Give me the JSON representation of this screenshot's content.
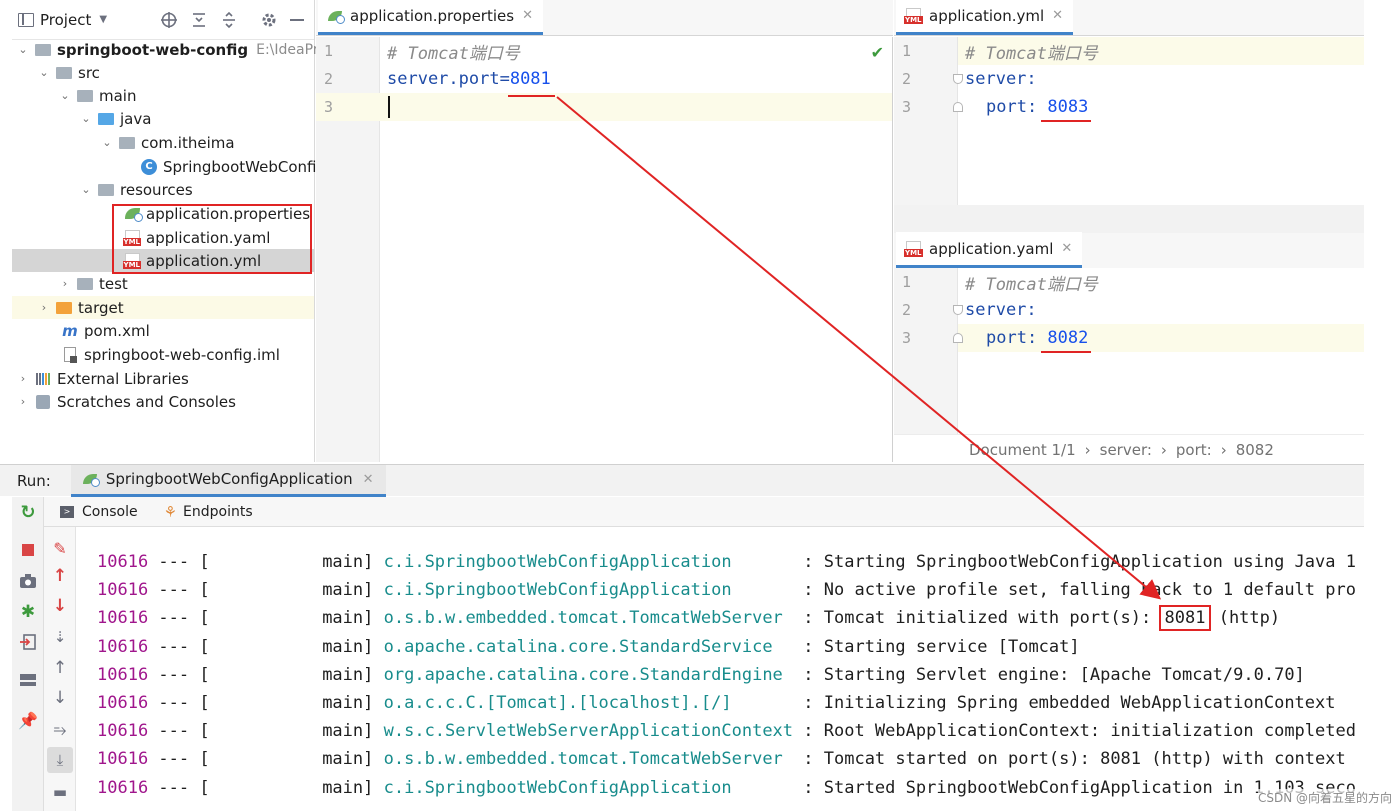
{
  "project": {
    "title": "Project",
    "tree": [
      {
        "label": "springboot-web-config",
        "hint": "E:\\IdeaProje"
      },
      {
        "label": "src"
      },
      {
        "label": "main"
      },
      {
        "label": "java"
      },
      {
        "label": "com.itheima"
      },
      {
        "label": "SpringbootWebConfi"
      },
      {
        "label": "resources"
      },
      {
        "label": "application.properties"
      },
      {
        "label": "application.yaml"
      },
      {
        "label": "application.yml"
      },
      {
        "label": "test"
      },
      {
        "label": "target"
      },
      {
        "label": "pom.xml"
      },
      {
        "label": "springboot-web-config.iml"
      },
      {
        "label": "External Libraries"
      },
      {
        "label": "Scratches and Consoles"
      }
    ]
  },
  "editor_main": {
    "tab": "application.properties",
    "lines": [
      "1",
      "2",
      "3"
    ],
    "comment": "# Tomcat端口号",
    "prop_key": "server.port=",
    "prop_val": "8081"
  },
  "editor_yml": {
    "tab": "application.yml",
    "lines": [
      "1",
      "2",
      "3"
    ],
    "comment": "# Tomcat端口号",
    "key1": "server:",
    "key2": "port: ",
    "val": "8083"
  },
  "editor_yaml": {
    "tab": "application.yaml",
    "lines": [
      "1",
      "2",
      "3"
    ],
    "comment": "# Tomcat端口号",
    "key1": "server:",
    "key2": "port: ",
    "val": "8082",
    "breadcrumb": [
      "Document 1/1",
      "›",
      "server:",
      "›",
      "port:",
      "›",
      "8082"
    ]
  },
  "run": {
    "label": "Run:",
    "config": "SpringbootWebConfigApplication",
    "tabs": [
      "Console",
      "Endpoints"
    ],
    "log": [
      {
        "pid": "10616",
        "sep": " --- [",
        "thread": "           main]",
        "cls": "c.i.SpringbootWebConfigApplication",
        "pad": "       ",
        "msg": ": Starting SpringbootWebConfigApplication using Java 1"
      },
      {
        "pid": "10616",
        "sep": " --- [",
        "thread": "           main]",
        "cls": "c.i.SpringbootWebConfigApplication",
        "pad": "       ",
        "msg": ": No active profile set, falling back to 1 default pro"
      },
      {
        "pid": "10616",
        "sep": " --- [",
        "thread": "           main]",
        "cls": "o.s.b.w.embedded.tomcat.TomcatWebServer",
        "pad": "  ",
        "msg_pre": ": Tomcat initialized with port(s): ",
        "msg_port": "8081",
        "msg_post": " (http)"
      },
      {
        "pid": "10616",
        "sep": " --- [",
        "thread": "           main]",
        "cls": "o.apache.catalina.core.StandardService",
        "pad": "   ",
        "msg": ": Starting service [Tomcat]"
      },
      {
        "pid": "10616",
        "sep": " --- [",
        "thread": "           main]",
        "cls": "org.apache.catalina.core.StandardEngine",
        "pad": "  ",
        "msg": ": Starting Servlet engine: [Apache Tomcat/9.0.70]"
      },
      {
        "pid": "10616",
        "sep": " --- [",
        "thread": "           main]",
        "cls": "o.a.c.c.C.[Tomcat].[localhost].[/]",
        "pad": "       ",
        "msg": ": Initializing Spring embedded WebApplicationContext"
      },
      {
        "pid": "10616",
        "sep": " --- [",
        "thread": "           main]",
        "cls": "w.s.c.ServletWebServerApplicationContext",
        "pad": " ",
        "msg": ": Root WebApplicationContext: initialization completed"
      },
      {
        "pid": "10616",
        "sep": " --- [",
        "thread": "           main]",
        "cls": "o.s.b.w.embedded.tomcat.TomcatWebServer",
        "pad": "  ",
        "msg": ": Tomcat started on port(s): 8081 (http) with context"
      },
      {
        "pid": "10616",
        "sep": " --- [",
        "thread": "           main]",
        "cls": "c.i.SpringbootWebConfigApplication",
        "pad": "       ",
        "msg": ": Started SpringbootWebConfigApplication in 1.103 seco"
      }
    ]
  },
  "watermark": "CSDN @向着五星的方向",
  "colors": {
    "annotation": "#e02424",
    "tab_underline": "#4083c9"
  }
}
